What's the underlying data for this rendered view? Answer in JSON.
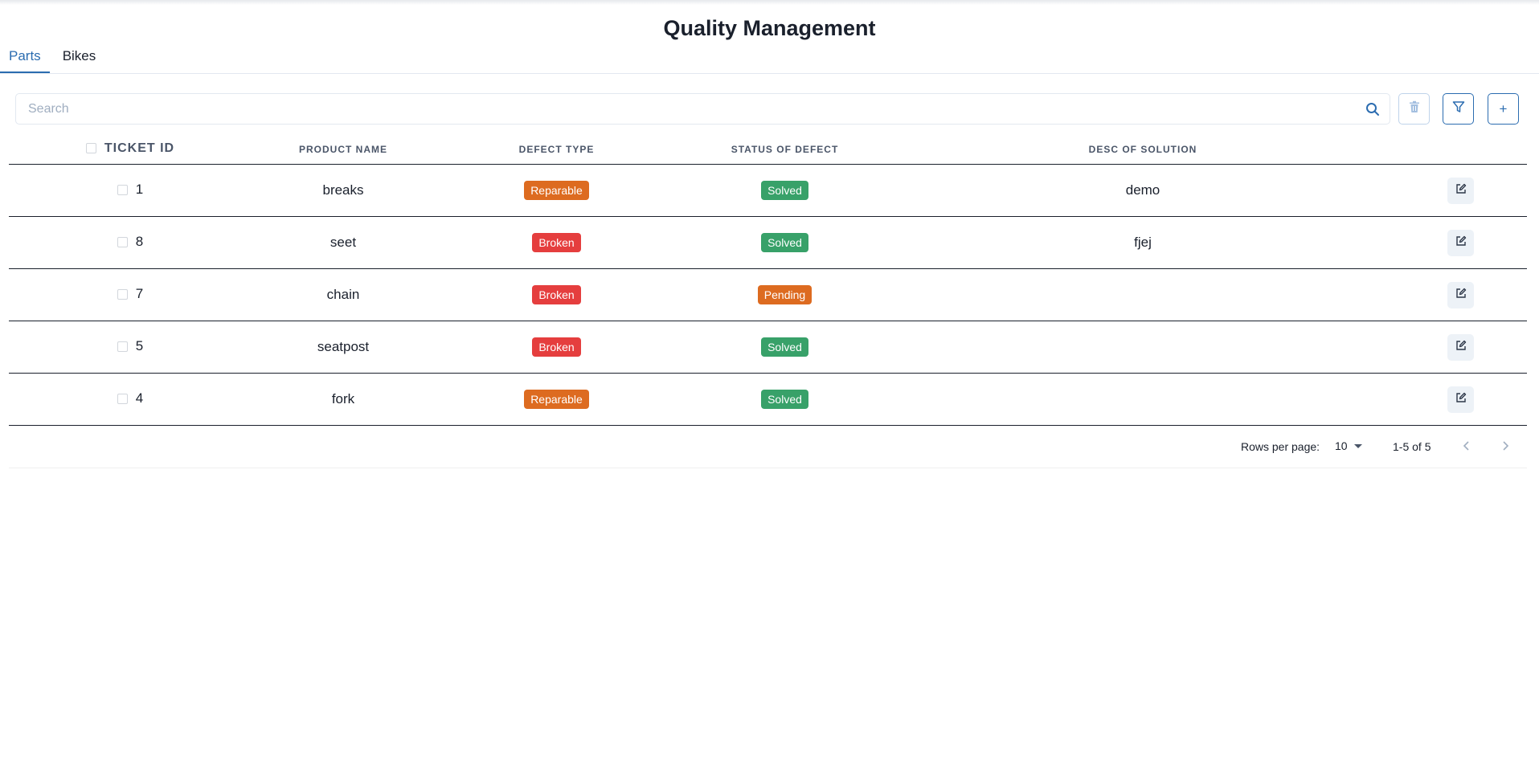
{
  "page": {
    "title": "Quality Management"
  },
  "tabs": [
    {
      "label": "Parts",
      "active": true
    },
    {
      "label": "Bikes",
      "active": false
    }
  ],
  "search": {
    "placeholder": "Search",
    "value": ""
  },
  "toolbar": {
    "add_label": "+"
  },
  "table": {
    "columns": [
      "TICKET ID",
      "PRODUCT NAME",
      "DEFECT TYPE",
      "STATUS OF DEFECT",
      "DESC OF SOLUTION"
    ],
    "rows": [
      {
        "ticket_id": "1",
        "product": "breaks",
        "defect_type": "Reparable",
        "status": "Solved",
        "solution": "demo"
      },
      {
        "ticket_id": "8",
        "product": "seet",
        "defect_type": "Broken",
        "status": "Solved",
        "solution": "fjej"
      },
      {
        "ticket_id": "7",
        "product": "chain",
        "defect_type": "Broken",
        "status": "Pending",
        "solution": ""
      },
      {
        "ticket_id": "5",
        "product": "seatpost",
        "defect_type": "Broken",
        "status": "Solved",
        "solution": ""
      },
      {
        "ticket_id": "4",
        "product": "fork",
        "defect_type": "Reparable",
        "status": "Solved",
        "solution": ""
      }
    ]
  },
  "badge_colors": {
    "Reparable": "#dd6b20",
    "Broken": "#e53e3e",
    "Solved": "#38a169",
    "Pending": "#dd6b20"
  },
  "pagination": {
    "rows_per_page_label": "Rows per page:",
    "rows_per_page": "10",
    "range": "1-5 of 5"
  },
  "icons": {
    "search": "search-icon",
    "delete": "trash-icon",
    "filter": "filter-icon",
    "edit": "edit-icon",
    "prev": "chevron-left-icon",
    "next": "chevron-right-icon"
  }
}
